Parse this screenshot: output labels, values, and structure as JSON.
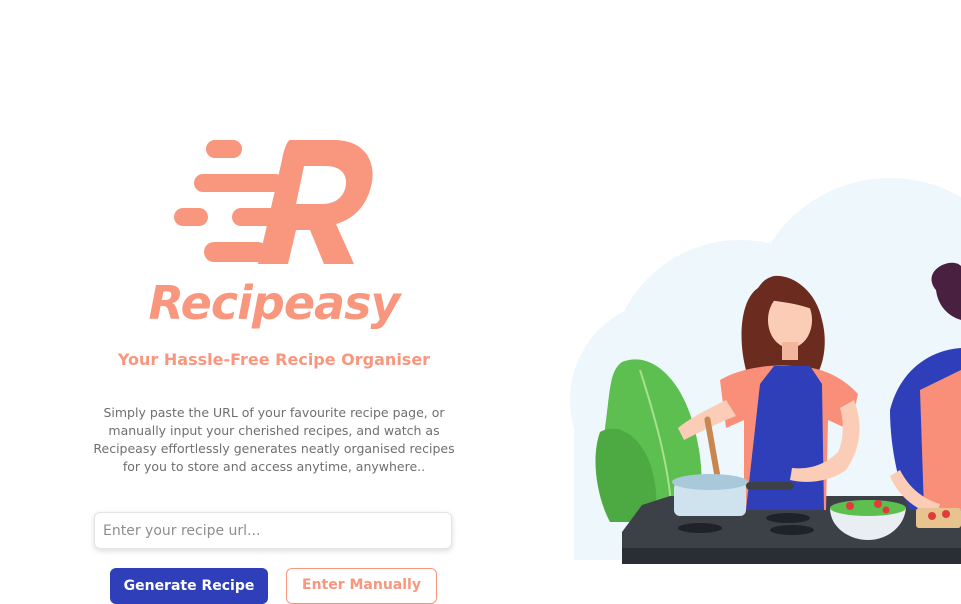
{
  "brand": {
    "name": "Recipeasy",
    "tagline": "Your Hassle-Free Recipe Organiser",
    "description": "Simply paste the URL of your favourite recipe page, or manually input your cherished recipes, and watch as Recipeasy effortlessly generates neatly organised recipes for you to store and access anytime, anywhere..",
    "accent_color": "#f9967e"
  },
  "form": {
    "url_placeholder": "Enter your recipe url...",
    "url_value": "",
    "generate_label": "Generate Recipe",
    "manual_label": "Enter Manually",
    "primary_color": "#2f3fba"
  },
  "illustration": {
    "subject": "two people cooking at a stove"
  }
}
